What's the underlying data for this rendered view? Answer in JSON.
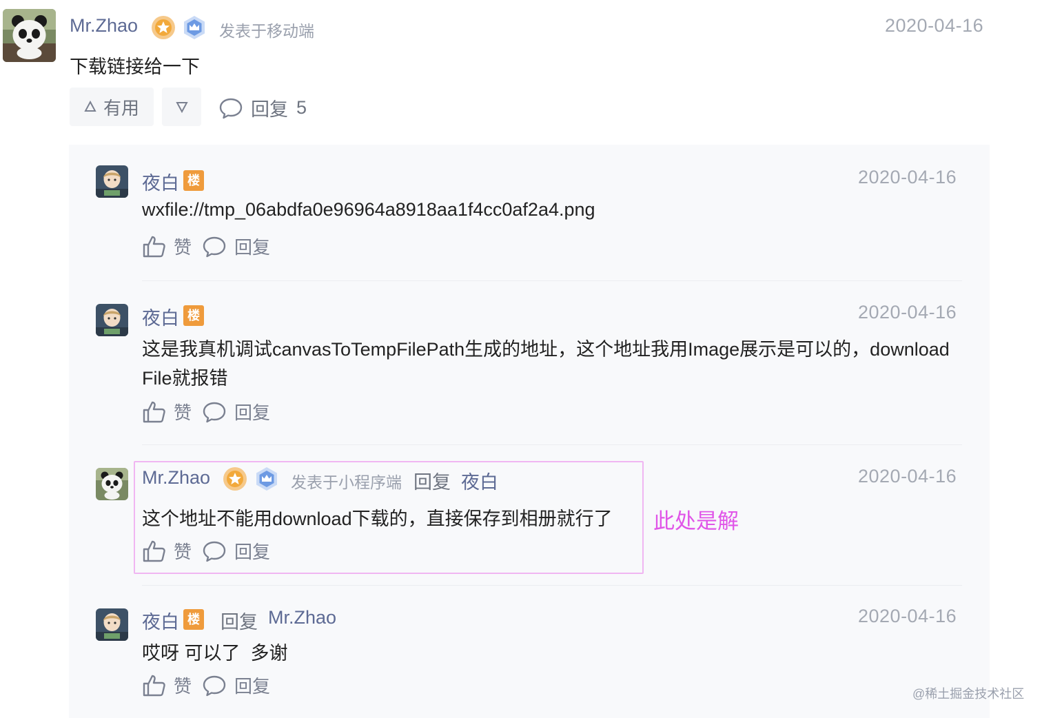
{
  "main": {
    "author": "Mr.Zhao",
    "source": "发表于移动端",
    "date": "2020-04-16",
    "content": "下载链接给一下",
    "useful_label": "有用",
    "reply_label": "回复",
    "reply_count": "5"
  },
  "replies": [
    {
      "author": "夜白",
      "badge": "楼",
      "date": "2020-04-16",
      "content": "wxfile://tmp_06abdfa0e96964a8918aa1f4cc0af2a4.png",
      "like_label": "赞",
      "reply_label": "回复"
    },
    {
      "author": "夜白",
      "badge": "楼",
      "date": "2020-04-16",
      "content_line1": "这是我真机调试canvasToTempFilePath生成的地址，这个地址我用Image展示是可以的，download",
      "content_line2": "File就报错",
      "like_label": "赞",
      "reply_label": "回复"
    },
    {
      "author": "Mr.Zhao",
      "source": "发表于小程序端",
      "reply_word": "回复",
      "reply_to": "夜白",
      "date": "2020-04-16",
      "content": "这个地址不能用download下载的，直接保存到相册就行了",
      "like_label": "赞",
      "reply_label": "回复"
    },
    {
      "author": "夜白",
      "badge": "楼",
      "reply_word": "回复",
      "reply_to": "Mr.Zhao",
      "date": "2020-04-16",
      "content": "哎呀 可以了  多谢",
      "like_label": "赞",
      "reply_label": "回复"
    }
  ],
  "annotation": "此处是解",
  "watermark": "@稀土掘金技术社区",
  "colors": {
    "name": "#5d6a94",
    "badge": "#ef9b3c",
    "annotation": "#e055e8",
    "highlight_border": "#f0b6f2"
  }
}
